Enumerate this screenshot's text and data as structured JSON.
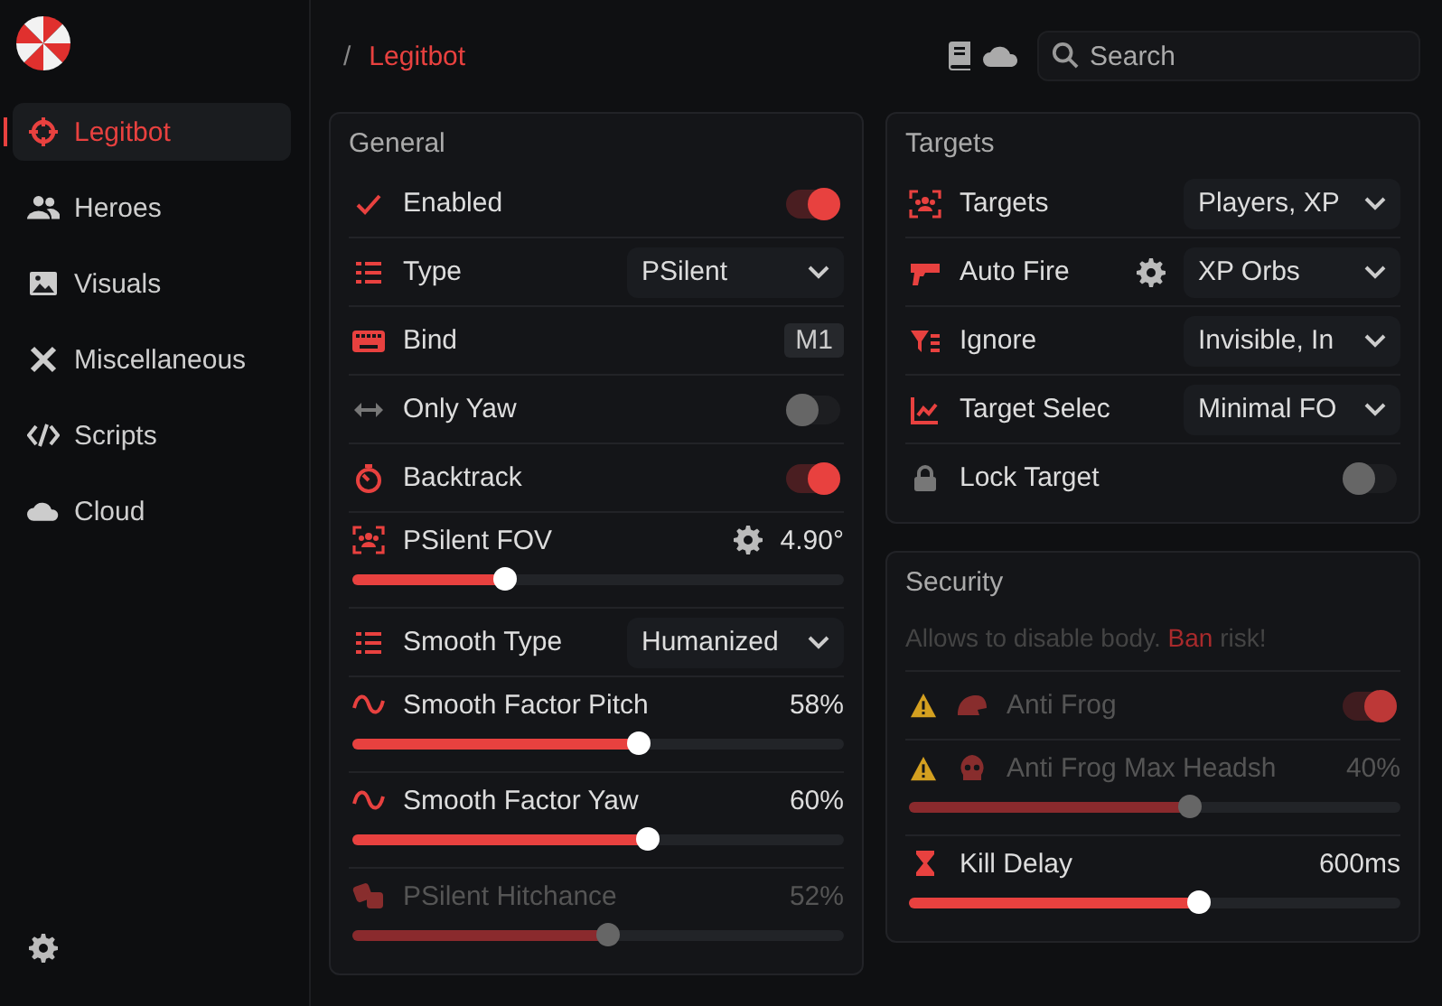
{
  "sidebar": {
    "items": [
      {
        "label": "Legitbot",
        "selected": true
      },
      {
        "label": "Heroes",
        "selected": false
      },
      {
        "label": "Visuals",
        "selected": false
      },
      {
        "label": "Miscellaneous",
        "selected": false
      },
      {
        "label": "Scripts",
        "selected": false
      },
      {
        "label": "Cloud",
        "selected": false
      }
    ]
  },
  "breadcrumb": {
    "separator": "/",
    "current": "Legitbot"
  },
  "search": {
    "placeholder": "Search"
  },
  "panels": [
    {
      "title": "General",
      "rows": [
        {
          "kind": "toggle",
          "label": "Enabled",
          "on": true
        },
        {
          "kind": "select",
          "label": "Type",
          "value": "PSilent"
        },
        {
          "kind": "bind",
          "label": "Bind",
          "value": "M1"
        },
        {
          "kind": "toggle",
          "label": "Only Yaw",
          "on": false
        },
        {
          "kind": "toggle",
          "label": "Backtrack",
          "on": true
        },
        {
          "kind": "slider",
          "label": "PSilent FOV",
          "reading": "4.90°",
          "level": 0.31,
          "gear": true
        },
        {
          "kind": "select",
          "label": "Smooth Type",
          "value": "Humanized"
        },
        {
          "kind": "slider",
          "label": "Smooth Factor Pitch",
          "reading": "58%",
          "level": 0.58
        },
        {
          "kind": "slider",
          "label": "Smooth Factor Yaw",
          "reading": "60%",
          "level": 0.6
        },
        {
          "kind": "slider",
          "label": "PSilent Hitchance",
          "reading": "52%",
          "level": 0.52,
          "disabled": true
        }
      ]
    },
    {
      "title": "Targets",
      "rows": [
        {
          "kind": "select",
          "label": "Targets",
          "value": "Players, XP"
        },
        {
          "kind": "select",
          "label": "Auto Fire",
          "value": "XP Orbs",
          "gear": true
        },
        {
          "kind": "select",
          "label": "Ignore",
          "value": "Invisible, In"
        },
        {
          "kind": "select",
          "label": "Target Selec",
          "value": "Minimal FO"
        },
        {
          "kind": "toggle",
          "label": "Lock Target",
          "on": false
        }
      ]
    },
    {
      "title": "Security",
      "note": "Allows to disable body. **Ban** risk!",
      "rows": [
        {
          "kind": "toggle",
          "label": "Anti Frog",
          "on": true,
          "disabled": true,
          "warning": true
        },
        {
          "kind": "slider",
          "label": "Anti Frog Max Headsh",
          "reading": "40%",
          "level": 0.57,
          "disabled": true,
          "warning": true
        },
        {
          "kind": "slider",
          "label": "Kill Delay",
          "reading": "600ms",
          "level": 0.59
        }
      ]
    }
  ]
}
